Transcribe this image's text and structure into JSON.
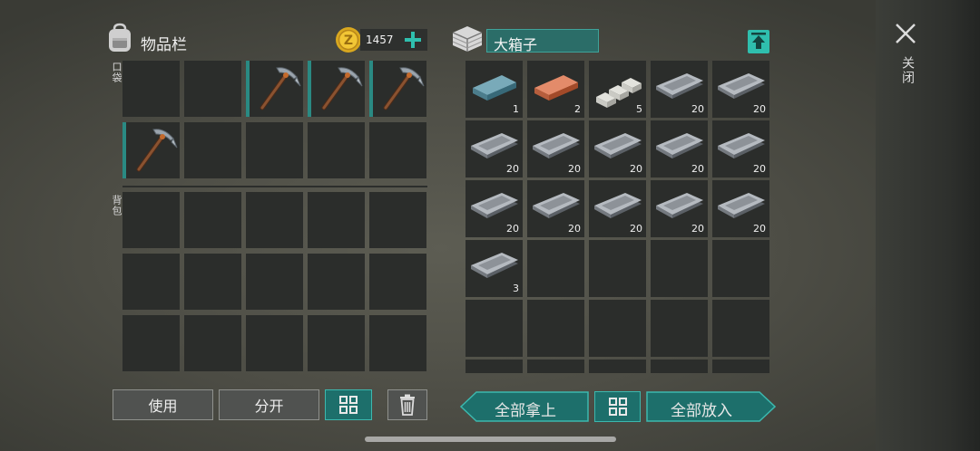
{
  "inventory": {
    "title": "物品栏",
    "coins": "1457",
    "pocket_label": "口袋",
    "backpack_label": "背包",
    "pocket_slots": [
      {
        "item": "",
        "equipped": false
      },
      {
        "item": "",
        "equipped": false
      },
      {
        "item": "pickaxe-icon",
        "equipped": true
      },
      {
        "item": "pickaxe-icon",
        "equipped": true
      },
      {
        "item": "pickaxe-icon",
        "equipped": true
      },
      {
        "item": "pickaxe-icon",
        "equipped": true
      },
      {
        "item": "",
        "equipped": false
      },
      {
        "item": "",
        "equipped": false
      },
      {
        "item": "",
        "equipped": false
      },
      {
        "item": "",
        "equipped": false
      }
    ],
    "use_label": "使用",
    "split_label": "分开"
  },
  "chest": {
    "name": "大箱子",
    "slots": [
      {
        "item": "copper-ore-ingot-icon",
        "color": "#4c7d8c",
        "qty": "1"
      },
      {
        "item": "copper-ingot-icon",
        "color": "#b65e3d",
        "qty": "2"
      },
      {
        "item": "limestone-bars-icon",
        "color": "#e3e3dd",
        "qty": "5"
      },
      {
        "item": "iron-plate-icon",
        "color": "#8d9298",
        "qty": "20"
      },
      {
        "item": "iron-plate-icon",
        "color": "#8d9298",
        "qty": "20"
      },
      {
        "item": "iron-plate-icon",
        "color": "#8d9298",
        "qty": "20"
      },
      {
        "item": "iron-plate-icon",
        "color": "#8d9298",
        "qty": "20"
      },
      {
        "item": "iron-plate-icon",
        "color": "#8d9298",
        "qty": "20"
      },
      {
        "item": "iron-plate-icon",
        "color": "#8d9298",
        "qty": "20"
      },
      {
        "item": "iron-plate-icon",
        "color": "#8d9298",
        "qty": "20"
      },
      {
        "item": "iron-plate-icon",
        "color": "#8d9298",
        "qty": "20"
      },
      {
        "item": "iron-plate-icon",
        "color": "#8d9298",
        "qty": "20"
      },
      {
        "item": "iron-plate-icon",
        "color": "#8d9298",
        "qty": "20"
      },
      {
        "item": "iron-plate-icon",
        "color": "#8d9298",
        "qty": "20"
      },
      {
        "item": "iron-plate-icon",
        "color": "#8d9298",
        "qty": "20"
      },
      {
        "item": "iron-plate-icon",
        "color": "#8d9298",
        "qty": "3"
      }
    ],
    "take_all_label": "全部拿上",
    "put_all_label": "全部放入"
  },
  "close_label": "关闭",
  "accent_color": "#1d6f6b"
}
